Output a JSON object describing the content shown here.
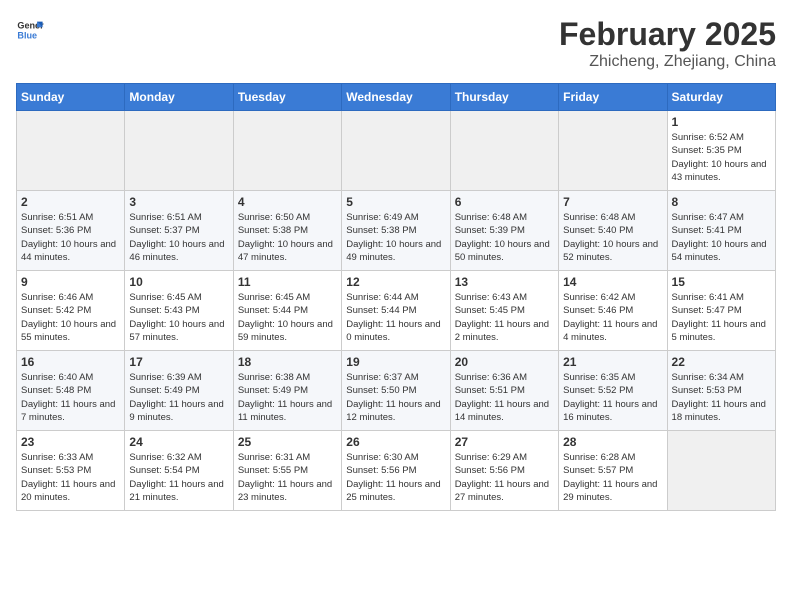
{
  "header": {
    "logo_general": "General",
    "logo_blue": "Blue",
    "month": "February 2025",
    "location": "Zhicheng, Zhejiang, China"
  },
  "weekdays": [
    "Sunday",
    "Monday",
    "Tuesday",
    "Wednesday",
    "Thursday",
    "Friday",
    "Saturday"
  ],
  "weeks": [
    [
      {
        "day": "",
        "info": ""
      },
      {
        "day": "",
        "info": ""
      },
      {
        "day": "",
        "info": ""
      },
      {
        "day": "",
        "info": ""
      },
      {
        "day": "",
        "info": ""
      },
      {
        "day": "",
        "info": ""
      },
      {
        "day": "1",
        "info": "Sunrise: 6:52 AM\nSunset: 5:35 PM\nDaylight: 10 hours and 43 minutes."
      }
    ],
    [
      {
        "day": "2",
        "info": "Sunrise: 6:51 AM\nSunset: 5:36 PM\nDaylight: 10 hours and 44 minutes."
      },
      {
        "day": "3",
        "info": "Sunrise: 6:51 AM\nSunset: 5:37 PM\nDaylight: 10 hours and 46 minutes."
      },
      {
        "day": "4",
        "info": "Sunrise: 6:50 AM\nSunset: 5:38 PM\nDaylight: 10 hours and 47 minutes."
      },
      {
        "day": "5",
        "info": "Sunrise: 6:49 AM\nSunset: 5:38 PM\nDaylight: 10 hours and 49 minutes."
      },
      {
        "day": "6",
        "info": "Sunrise: 6:48 AM\nSunset: 5:39 PM\nDaylight: 10 hours and 50 minutes."
      },
      {
        "day": "7",
        "info": "Sunrise: 6:48 AM\nSunset: 5:40 PM\nDaylight: 10 hours and 52 minutes."
      },
      {
        "day": "8",
        "info": "Sunrise: 6:47 AM\nSunset: 5:41 PM\nDaylight: 10 hours and 54 minutes."
      }
    ],
    [
      {
        "day": "9",
        "info": "Sunrise: 6:46 AM\nSunset: 5:42 PM\nDaylight: 10 hours and 55 minutes."
      },
      {
        "day": "10",
        "info": "Sunrise: 6:45 AM\nSunset: 5:43 PM\nDaylight: 10 hours and 57 minutes."
      },
      {
        "day": "11",
        "info": "Sunrise: 6:45 AM\nSunset: 5:44 PM\nDaylight: 10 hours and 59 minutes."
      },
      {
        "day": "12",
        "info": "Sunrise: 6:44 AM\nSunset: 5:44 PM\nDaylight: 11 hours and 0 minutes."
      },
      {
        "day": "13",
        "info": "Sunrise: 6:43 AM\nSunset: 5:45 PM\nDaylight: 11 hours and 2 minutes."
      },
      {
        "day": "14",
        "info": "Sunrise: 6:42 AM\nSunset: 5:46 PM\nDaylight: 11 hours and 4 minutes."
      },
      {
        "day": "15",
        "info": "Sunrise: 6:41 AM\nSunset: 5:47 PM\nDaylight: 11 hours and 5 minutes."
      }
    ],
    [
      {
        "day": "16",
        "info": "Sunrise: 6:40 AM\nSunset: 5:48 PM\nDaylight: 11 hours and 7 minutes."
      },
      {
        "day": "17",
        "info": "Sunrise: 6:39 AM\nSunset: 5:49 PM\nDaylight: 11 hours and 9 minutes."
      },
      {
        "day": "18",
        "info": "Sunrise: 6:38 AM\nSunset: 5:49 PM\nDaylight: 11 hours and 11 minutes."
      },
      {
        "day": "19",
        "info": "Sunrise: 6:37 AM\nSunset: 5:50 PM\nDaylight: 11 hours and 12 minutes."
      },
      {
        "day": "20",
        "info": "Sunrise: 6:36 AM\nSunset: 5:51 PM\nDaylight: 11 hours and 14 minutes."
      },
      {
        "day": "21",
        "info": "Sunrise: 6:35 AM\nSunset: 5:52 PM\nDaylight: 11 hours and 16 minutes."
      },
      {
        "day": "22",
        "info": "Sunrise: 6:34 AM\nSunset: 5:53 PM\nDaylight: 11 hours and 18 minutes."
      }
    ],
    [
      {
        "day": "23",
        "info": "Sunrise: 6:33 AM\nSunset: 5:53 PM\nDaylight: 11 hours and 20 minutes."
      },
      {
        "day": "24",
        "info": "Sunrise: 6:32 AM\nSunset: 5:54 PM\nDaylight: 11 hours and 21 minutes."
      },
      {
        "day": "25",
        "info": "Sunrise: 6:31 AM\nSunset: 5:55 PM\nDaylight: 11 hours and 23 minutes."
      },
      {
        "day": "26",
        "info": "Sunrise: 6:30 AM\nSunset: 5:56 PM\nDaylight: 11 hours and 25 minutes."
      },
      {
        "day": "27",
        "info": "Sunrise: 6:29 AM\nSunset: 5:56 PM\nDaylight: 11 hours and 27 minutes."
      },
      {
        "day": "28",
        "info": "Sunrise: 6:28 AM\nSunset: 5:57 PM\nDaylight: 11 hours and 29 minutes."
      },
      {
        "day": "",
        "info": ""
      }
    ]
  ]
}
